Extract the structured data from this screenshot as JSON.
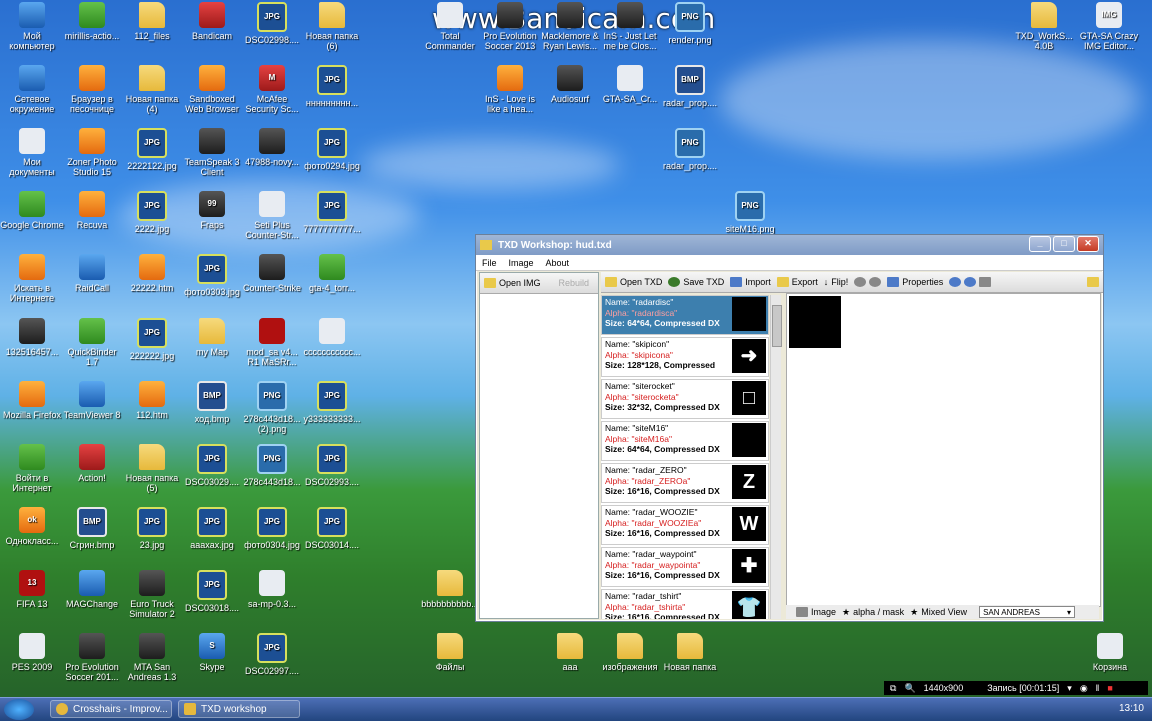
{
  "watermark": "www.Bandicam.com",
  "icons": [
    {
      "label": "Мой компьютер",
      "kind": "blue",
      "glyph": ""
    },
    {
      "label": "mirillis-actio...",
      "kind": "green",
      "glyph": ""
    },
    {
      "label": "112_files",
      "kind": "folder",
      "glyph": ""
    },
    {
      "label": "Bandicam",
      "kind": "app",
      "glyph": ""
    },
    {
      "label": "DSC02998....",
      "kind": "jpg",
      "glyph": "JPG"
    },
    {
      "label": "Новая папка (6)",
      "kind": "folder",
      "glyph": ""
    },
    {
      "label": "Сетевое окружение",
      "kind": "blue",
      "glyph": ""
    },
    {
      "label": "Браузер в песочнице",
      "kind": "orange",
      "glyph": ""
    },
    {
      "label": "Новая папка (4)",
      "kind": "folder",
      "glyph": ""
    },
    {
      "label": "Sandboxed Web Browser",
      "kind": "orange",
      "glyph": ""
    },
    {
      "label": "McAfee Security Sc...",
      "kind": "app",
      "glyph": "M"
    },
    {
      "label": "ннннннннн...",
      "kind": "jpg",
      "glyph": "JPG"
    },
    {
      "label": "Мои документы",
      "kind": "white",
      "glyph": ""
    },
    {
      "label": "Zoner Photo Studio 15",
      "kind": "orange",
      "glyph": ""
    },
    {
      "label": "2222122.jpg",
      "kind": "jpg",
      "glyph": "JPG"
    },
    {
      "label": "TeamSpeak 3 Client",
      "kind": "dark",
      "glyph": ""
    },
    {
      "label": "47988-novy...",
      "kind": "dark",
      "glyph": ""
    },
    {
      "label": "фото0294.jpg",
      "kind": "jpg",
      "glyph": "JPG"
    },
    {
      "label": "Google Chrome",
      "kind": "green",
      "glyph": ""
    },
    {
      "label": "Recuva",
      "kind": "orange",
      "glyph": ""
    },
    {
      "label": "2222.jpg",
      "kind": "jpg",
      "glyph": "JPG"
    },
    {
      "label": "Fraps",
      "kind": "dark",
      "glyph": "99"
    },
    {
      "label": "Seti Plus Counter-Str...",
      "kind": "white",
      "glyph": ""
    },
    {
      "label": "7777777777...",
      "kind": "jpg",
      "glyph": "JPG"
    },
    {
      "label": "Искать в Интернете",
      "kind": "orange",
      "glyph": ""
    },
    {
      "label": "RaidCall",
      "kind": "blue",
      "glyph": ""
    },
    {
      "label": "22222.htm",
      "kind": "orange",
      "glyph": ""
    },
    {
      "label": "фото0303.jpg",
      "kind": "jpg",
      "glyph": "JPG"
    },
    {
      "label": "Counter-Strike",
      "kind": "dark",
      "glyph": ""
    },
    {
      "label": "gta-4_torr...",
      "kind": "green",
      "glyph": ""
    },
    {
      "label": "132516457...",
      "kind": "dark",
      "glyph": ""
    },
    {
      "label": "QuickBinder 1.7",
      "kind": "green",
      "glyph": ""
    },
    {
      "label": "222222.jpg",
      "kind": "jpg",
      "glyph": "JPG"
    },
    {
      "label": "my Map",
      "kind": "folder",
      "glyph": ""
    },
    {
      "label": "mod_sa v4... R1 MaSRr...",
      "kind": "red",
      "glyph": ""
    },
    {
      "label": "ccccccccccc...",
      "kind": "white",
      "glyph": ""
    },
    {
      "label": "Mozilla Firefox",
      "kind": "orange",
      "glyph": ""
    },
    {
      "label": "TeamViewer 8",
      "kind": "blue",
      "glyph": ""
    },
    {
      "label": "112.htm",
      "kind": "orange",
      "glyph": ""
    },
    {
      "label": "ход.bmp",
      "kind": "bmp",
      "glyph": "BMP"
    },
    {
      "label": "278c443d18... (2).png",
      "kind": "png",
      "glyph": "PNG"
    },
    {
      "label": "y333333333...",
      "kind": "jpg",
      "glyph": "JPG"
    },
    {
      "label": "Войти в Интернет",
      "kind": "green",
      "glyph": ""
    },
    {
      "label": "Action!",
      "kind": "app",
      "glyph": ""
    },
    {
      "label": "Новая папка (5)",
      "kind": "folder",
      "glyph": ""
    },
    {
      "label": "DSC03029....",
      "kind": "jpg",
      "glyph": "JPG"
    },
    {
      "label": "278c443d18...",
      "kind": "png",
      "glyph": "PNG"
    },
    {
      "label": "DSC02993....",
      "kind": "jpg",
      "glyph": "JPG"
    },
    {
      "label": "Однокласс...",
      "kind": "orange",
      "glyph": "ok"
    },
    {
      "label": "Сгрин.bmp",
      "kind": "bmp",
      "glyph": "BMP"
    },
    {
      "label": "23.jpg",
      "kind": "jpg",
      "glyph": "JPG"
    },
    {
      "label": "aaaxax.jpg",
      "kind": "jpg",
      "glyph": "JPG"
    },
    {
      "label": "фото0304.jpg",
      "kind": "jpg",
      "glyph": "JPG"
    },
    {
      "label": "DSC03014....",
      "kind": "jpg",
      "glyph": "JPG"
    },
    {
      "label": "FIFA 13",
      "kind": "red",
      "glyph": "13"
    },
    {
      "label": "MAGChange",
      "kind": "blue",
      "glyph": ""
    },
    {
      "label": "Euro Truck Simulator 2",
      "kind": "dark",
      "glyph": ""
    },
    {
      "label": "DSC03018....",
      "kind": "jpg",
      "glyph": "JPG"
    },
    {
      "label": "sa-mp-0.3...",
      "kind": "white",
      "glyph": ""
    },
    {
      "label": "PES 2009",
      "kind": "white",
      "glyph": ""
    },
    {
      "label": "Pro Evolution Soccer 201...",
      "kind": "dark",
      "glyph": ""
    },
    {
      "label": "MTA San Andreas 1.3",
      "kind": "dark",
      "glyph": ""
    },
    {
      "label": "Skype",
      "kind": "blue",
      "glyph": "S"
    },
    {
      "label": "DSC02997....",
      "kind": "jpg",
      "glyph": "JPG"
    },
    {
      "label": "Total Commander",
      "kind": "white",
      "glyph": ""
    },
    {
      "label": "Pro Evolution Soccer 2013",
      "kind": "dark",
      "glyph": ""
    },
    {
      "label": "Macklemore & Ryan Lewis...",
      "kind": "dark",
      "glyph": ""
    },
    {
      "label": "InS - Just Let me be Clos...",
      "kind": "dark",
      "glyph": ""
    },
    {
      "label": "render.png",
      "kind": "png",
      "glyph": "PNG"
    },
    {
      "label": "InS - Love is like a hea...",
      "kind": "orange",
      "glyph": ""
    },
    {
      "label": "Audiosurf",
      "kind": "dark",
      "glyph": ""
    },
    {
      "label": "GTA-SA_Cr...",
      "kind": "white",
      "glyph": ""
    },
    {
      "label": "radar_prop....",
      "kind": "bmp",
      "glyph": "BMP"
    },
    {
      "label": "radar_prop....",
      "kind": "png",
      "glyph": "PNG"
    },
    {
      "label": "siteM16.png",
      "kind": "png",
      "glyph": "PNG"
    },
    {
      "label": "bbbbbbbbbb...",
      "kind": "folder",
      "glyph": ""
    },
    {
      "label": "Файлы",
      "kind": "folder",
      "glyph": ""
    },
    {
      "label": "aaa",
      "kind": "folder",
      "glyph": ""
    },
    {
      "label": "изображения",
      "kind": "folder",
      "glyph": ""
    },
    {
      "label": "Новая папка",
      "kind": "folder",
      "glyph": ""
    },
    {
      "label": "TXD_WorkS... 4.0B",
      "kind": "folder",
      "glyph": ""
    },
    {
      "label": "GTA-SA Crazy IMG Editor...",
      "kind": "white",
      "glyph": "IMG"
    },
    {
      "label": "Корзина",
      "kind": "white",
      "glyph": ""
    }
  ],
  "txd": {
    "title": "TXD Workshop: hud.txd",
    "menu": [
      "File",
      "Image",
      "About"
    ],
    "open_img": "Open IMG",
    "rebuild": "Rebuild",
    "toolbar": [
      "Open TXD",
      "Save TXD",
      "Import",
      "Export",
      "Flip!",
      "Properties"
    ],
    "textures": [
      {
        "name": "Name: \"radardisc\"",
        "alpha": "Alpha: \"radardisca\"",
        "size": "Size: 64*64, Compressed DX",
        "thumb": ""
      },
      {
        "name": "Name: \"skipicon\"",
        "alpha": "Alpha: \"skipicona\"",
        "size": "Size: 128*128, Compressed",
        "thumb": "➜"
      },
      {
        "name": "Name: \"siterocket\"",
        "alpha": "Alpha: \"siterocketa\"",
        "size": "Size: 32*32, Compressed DX",
        "thumb": "□"
      },
      {
        "name": "Name: \"siteM16\"",
        "alpha": "Alpha: \"siteM16a\"",
        "size": "Size: 64*64, Compressed DX",
        "thumb": ""
      },
      {
        "name": "Name: \"radar_ZERO\"",
        "alpha": "Alpha: \"radar_ZEROa\"",
        "size": "Size: 16*16, Compressed DX",
        "thumb": "Z"
      },
      {
        "name": "Name: \"radar_WOOZIE\"",
        "alpha": "Alpha: \"radar_WOOZIEa\"",
        "size": "Size: 16*16, Compressed DX",
        "thumb": "W"
      },
      {
        "name": "Name: \"radar_waypoint\"",
        "alpha": "Alpha: \"radar_waypointa\"",
        "size": "Size: 16*16, Compressed DX",
        "thumb": "✚"
      },
      {
        "name": "Name: \"radar_tshirt\"",
        "alpha": "Alpha: \"radar_tshirta\"",
        "size": "Size: 16*16, Compressed DX",
        "thumb": "👕"
      },
      {
        "name": "Name: \"radar_truck\"",
        "alpha": "Alpha: \"radar_trucka\"",
        "size": "",
        "thumb": ""
      }
    ],
    "tabs": [
      "Image",
      "alpha / mask",
      "Mixed View"
    ],
    "game": "SAN ANDREAS"
  },
  "bandicam": {
    "resolution": "1440x900",
    "recording": "Запись [00:01:15]"
  },
  "taskbar": {
    "items": [
      "Crosshairs - Improv...",
      "TXD workshop"
    ],
    "time": "13:10"
  }
}
